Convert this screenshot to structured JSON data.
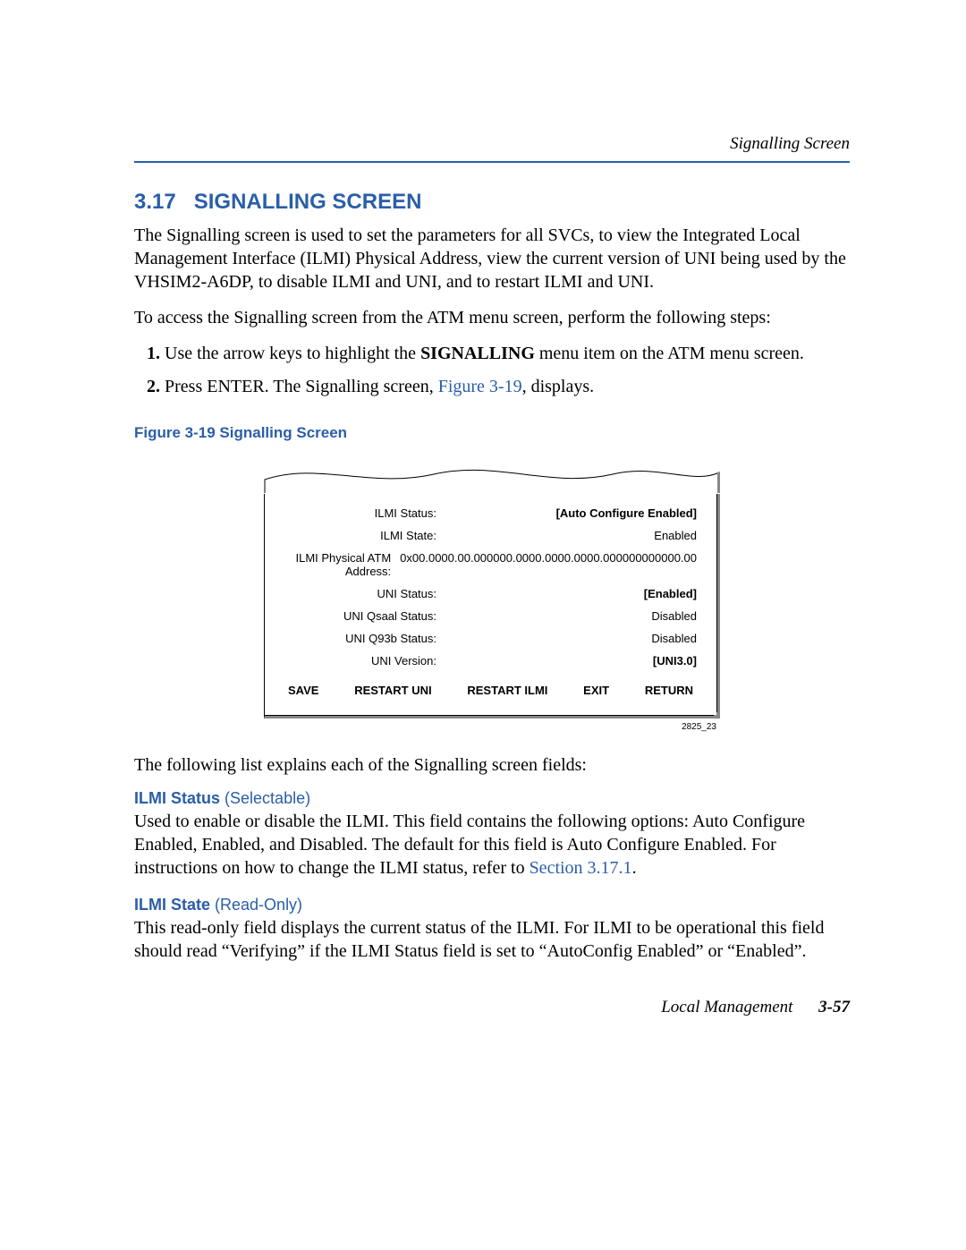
{
  "header": {
    "running": "Signalling Screen"
  },
  "section": {
    "number": "3.17",
    "title": "SIGNALLING SCREEN",
    "intro": "The Signalling screen is used to set the parameters for all SVCs, to view the Integrated Local Management Interface (ILMI) Physical Address, view the current version of UNI being used by the VHSIM2-A6DP, to disable ILMI and UNI, and to restart ILMI and UNI.",
    "access": "To access the Signalling screen from the ATM menu screen, perform the following steps:"
  },
  "steps": {
    "s1_pre": "Use the arrow keys to highlight the ",
    "s1_bold": "SIGNALLING",
    "s1_post": " menu item on the ATM menu screen.",
    "s2_pre": "Press ENTER. The Signalling screen, ",
    "s2_link": "Figure 3-19",
    "s2_post": ", displays."
  },
  "figure": {
    "caption": "Figure 3-19   Signalling Screen",
    "rows": {
      "ilmi_status_label": "ILMI Status:",
      "ilmi_status_value": "[Auto Configure Enabled]",
      "ilmi_state_label": "ILMI State:",
      "ilmi_state_value": "Enabled",
      "addr_label": "ILMI Physical ATM Address:",
      "addr_value": "0x00.0000.00.000000.0000.0000.0000.000000000000.00",
      "uni_status_label": "UNI Status:",
      "uni_status_value": "[Enabled]",
      "uni_qsaal_label": "UNI Qsaal Status:",
      "uni_qsaal_value": "Disabled",
      "uni_q93b_label": "UNI Q93b Status:",
      "uni_q93b_value": "Disabled",
      "uni_version_label": "UNI Version:",
      "uni_version_value": "[UNI3.0]"
    },
    "actions": {
      "save": "SAVE",
      "restart_uni": "RESTART UNI",
      "restart_ilmi": "RESTART ILMI",
      "exit": "EXIT",
      "return": "RETURN"
    },
    "art_id": "2825_23"
  },
  "after_figure": "The following list explains each of the Signalling screen fields:",
  "fields": {
    "ilmi_status": {
      "name": "ILMI Status",
      "tag": "(Selectable)",
      "desc_pre": "Used to enable or disable the ILMI. This field contains the following options: Auto Configure Enabled, Enabled, and Disabled. The default for this field is Auto Configure Enabled. For instructions on how to change the ILMI status, refer to ",
      "desc_link": "Section 3.17.1",
      "desc_post": "."
    },
    "ilmi_state": {
      "name": "ILMI State",
      "tag": "(Read-Only)",
      "desc": "This read-only field displays the current status of the ILMI. For ILMI to be operational this field should read “Verifying” if the ILMI Status field is set to “AutoConfig Enabled” or “Enabled”."
    }
  },
  "footer": {
    "doc": "Local Management",
    "page": "3-57"
  }
}
